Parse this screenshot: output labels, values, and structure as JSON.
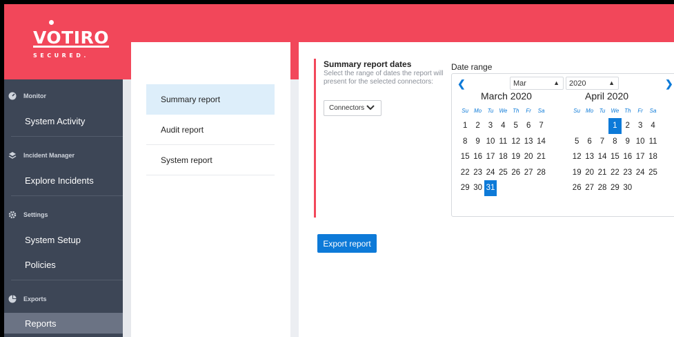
{
  "logo": {
    "main": "VOTIRO",
    "sub": "SECURED."
  },
  "sidebar": {
    "sections": [
      {
        "header": "Monitor",
        "icon": "gauge-icon",
        "items": [
          {
            "label": "System Activity",
            "active": false
          }
        ]
      },
      {
        "header": "Incident Manager",
        "icon": "layers-icon",
        "items": [
          {
            "label": "Explore Incidents",
            "active": false
          }
        ]
      },
      {
        "header": "Settings",
        "icon": "gear-icon",
        "items": [
          {
            "label": "System Setup",
            "active": false
          },
          {
            "label": "Policies",
            "active": false
          }
        ]
      },
      {
        "header": "Exports",
        "icon": "pie-chart-icon",
        "items": [
          {
            "label": "Reports",
            "active": true
          }
        ]
      }
    ]
  },
  "reports": {
    "items": [
      {
        "label": "Summary report",
        "active": true
      },
      {
        "label": "Audit report",
        "active": false
      },
      {
        "label": "System report",
        "active": false
      }
    ]
  },
  "summary": {
    "title": "Summary report dates",
    "description": "Select the range of dates the report will present for the selected connectors:",
    "connectors_label": "Connectors",
    "export_label": "Export report"
  },
  "calendar": {
    "label": "Date range",
    "month_select": "Mar",
    "year_select": "2020",
    "weekdays": [
      "Su",
      "Mo",
      "Tu",
      "We",
      "Th",
      "Fr",
      "Sa"
    ],
    "months": [
      {
        "title": "March 2020",
        "first_weekday": 0,
        "days": 31,
        "selected": [
          31
        ]
      },
      {
        "title": "April 2020",
        "first_weekday": 3,
        "days": 30,
        "selected": [
          1
        ]
      }
    ]
  },
  "colors": {
    "brand": "#f2475a",
    "sidebar": "#3d4656",
    "accent": "#0d7ad8"
  }
}
